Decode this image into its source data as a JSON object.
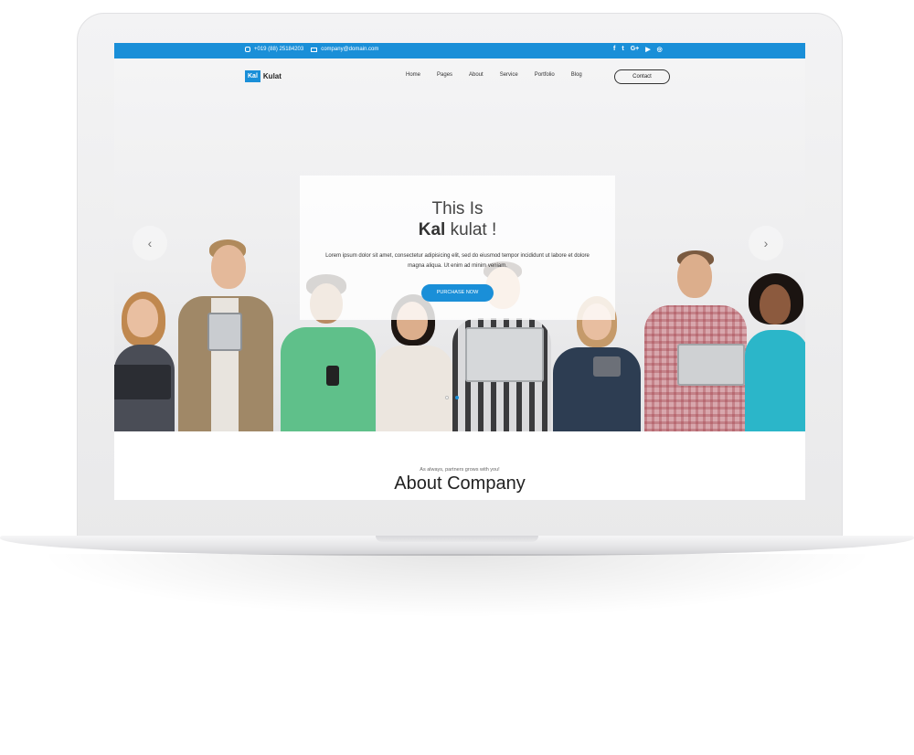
{
  "topbar": {
    "phone": "+019 (88) 25184203",
    "email": "company@domain.com",
    "social": [
      {
        "name": "facebook-icon",
        "glyph": "f"
      },
      {
        "name": "twitter-icon",
        "glyph": "t"
      },
      {
        "name": "google-plus-icon",
        "glyph": "G+"
      },
      {
        "name": "youtube-icon",
        "glyph": "▶"
      },
      {
        "name": "instagram-icon",
        "glyph": "◎"
      }
    ]
  },
  "brand": {
    "box": "Kal",
    "text": "Kulat",
    "accent": "#1a8fd8"
  },
  "nav": {
    "items": [
      "Home",
      "Pages",
      "About",
      "Service",
      "Portfolio",
      "Blog"
    ],
    "contact": "Contact"
  },
  "hero": {
    "line1": "This Is",
    "line2_bold": "Kal",
    "line2_rest": "kulat !",
    "description": "Lorem ipsum dolor sit amet, consectetur adipisicing elit, sed do eiusmod tempor incididunt ut labore et dolore magna aliqua. Ut enim ad minim veniam.",
    "button": "PURCHASE NOW",
    "prev_icon": "‹",
    "next_icon": "›"
  },
  "about": {
    "subtitle": "As always, partners grows with you!",
    "title": "About Company"
  }
}
